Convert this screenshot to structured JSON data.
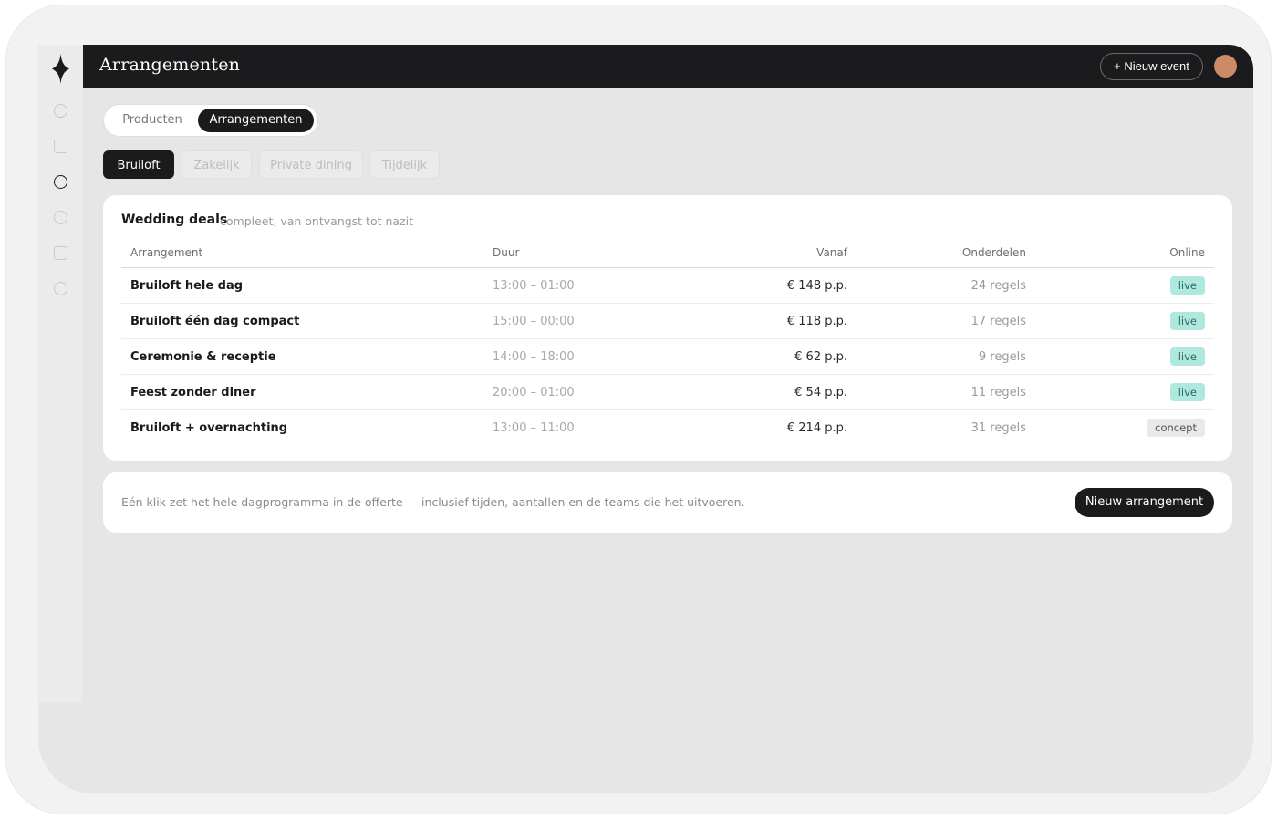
{
  "header": {
    "title": "Arrangementen",
    "new_event_label": "+ Nieuw event"
  },
  "sidebar": {
    "icons": [
      "circle-icon",
      "square-icon",
      "circle-icon",
      "circle-icon",
      "square-icon",
      "circle-icon"
    ],
    "active_index": 2
  },
  "segments": [
    "Producten",
    "Arrangementen"
  ],
  "segments_active": "Arrangementen",
  "chips": [
    "Bruiloft",
    "Zakelijk",
    "Private dining",
    "Tijdelijk"
  ],
  "chips_active": "Bruiloft",
  "card": {
    "title": "Wedding deals",
    "subtitle": "compleet, van ontvangst tot nazit",
    "columns": [
      "Arrangement",
      "Duur",
      "Vanaf",
      "Onderdelen",
      "Online"
    ],
    "rows": [
      {
        "name": "Bruiloft hele dag",
        "duration": "13:00 – 01:00",
        "price": "€ 148 p.p.",
        "parts": "24 regels",
        "status": "live"
      },
      {
        "name": "Bruiloft één dag compact",
        "duration": "15:00 – 00:00",
        "price": "€ 118 p.p.",
        "parts": "17 regels",
        "status": "live"
      },
      {
        "name": "Ceremonie & receptie",
        "duration": "14:00 – 18:00",
        "price": "€ 62 p.p.",
        "parts": "9 regels",
        "status": "live"
      },
      {
        "name": "Feest zonder diner",
        "duration": "20:00 – 01:00",
        "price": "€ 54 p.p.",
        "parts": "11 regels",
        "status": "live"
      },
      {
        "name": "Bruiloft + overnachting",
        "duration": "13:00 – 11:00",
        "price": "€ 214 p.p.",
        "parts": "31 regels",
        "status": "concept"
      }
    ]
  },
  "footer": {
    "note": "Eén klik zet het hele dagprogramma in de offerte — inclusief tijden, aantallen en de teams die het uitvoeren.",
    "cta_label": "Nieuw arrangement"
  },
  "colors": {
    "dark": "#1b1b1d",
    "avatar": "#cc8a66",
    "live_badge": "#aee8df"
  }
}
